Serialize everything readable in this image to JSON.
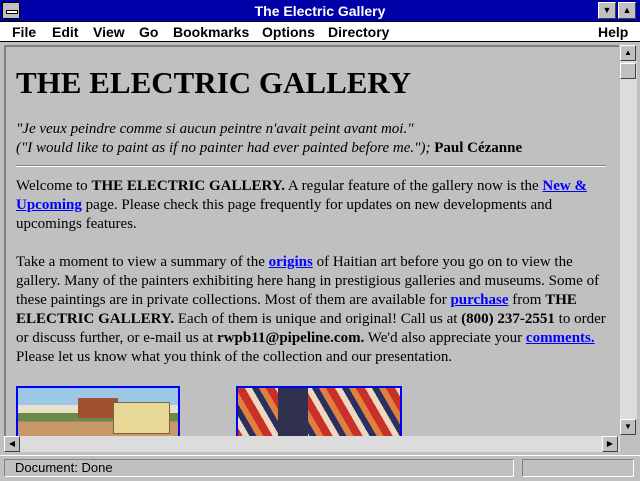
{
  "window": {
    "title": "The Electric Gallery"
  },
  "menubar": {
    "items": [
      "File",
      "Edit",
      "View",
      "Go",
      "Bookmarks",
      "Options",
      "Directory",
      "Help"
    ]
  },
  "page": {
    "heading": "THE ELECTRIC GALLERY",
    "quote_fr": "\"Je veux peindre comme si aucun peintre n'avait peint avant moi.\"",
    "quote_en": "(\"I would like to paint as if no painter had ever painted before me.\");",
    "quote_author": "Paul Cézanne",
    "p1": {
      "t1": "Welcome to ",
      "b1": "THE ELECTRIC GALLERY.",
      "t2": " A regular feature of the gallery now is the ",
      "link_new": "New & Upcoming",
      "t3": " page. Please check this page frequently for updates on new developments and upcomings features."
    },
    "p2": {
      "t1": "Take a moment to view a summary of the ",
      "link_origins": "origins",
      "t2": " of Haitian art before you go on to view the gallery. Many of the painters exhibiting here hang in prestigious galleries and museums. Some of these paintings are in private collections. Most of them are available for ",
      "link_purchase": "purchase",
      "t3": " from ",
      "b1": "THE ELECTRIC GALLERY.",
      "t4": " Each of them is unique and original! Call us at ",
      "phone": "(800) 237-2551",
      "t5": " to order or discuss further, or e-mail us at ",
      "email": "rwpb11@pipeline.com.",
      "t6": " We'd also appreciate your ",
      "link_comments": "comments.",
      "t7": " Please let us know what you think of the collection and our presentation."
    }
  },
  "statusbar": {
    "text": "Document: Done"
  }
}
